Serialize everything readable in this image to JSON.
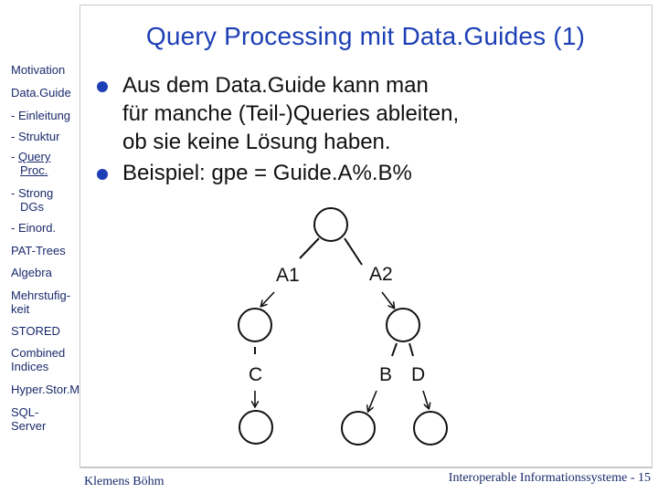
{
  "title": "Query Processing mit Data.Guides (1)",
  "sidebar": {
    "items": [
      {
        "label": "Motivation"
      },
      {
        "label": "Data.Guide"
      },
      {
        "label": "- Einleitung"
      },
      {
        "label": "- Struktur"
      },
      {
        "prefix": "- ",
        "label_line1": "Query",
        "label_line2": "Proc.",
        "active": true
      },
      {
        "label_line1": "- Strong",
        "label_line2": "DGs"
      },
      {
        "label": "- Einord."
      },
      {
        "label": "PAT-Trees"
      },
      {
        "label": "Algebra"
      },
      {
        "label_line1": "Mehrstufig-",
        "label_line2": "keit"
      },
      {
        "label": "STORED"
      },
      {
        "label_line1": "Combined",
        "label_line2": "Indices"
      },
      {
        "label": "Hyper.Stor.M"
      },
      {
        "label_line1": "SQL-",
        "label_line2": "Server"
      }
    ]
  },
  "bullets": [
    {
      "lines": [
        "Aus dem Data.Guide kann man",
        "für manche (Teil-)Queries ableiten,",
        "ob sie keine Lösung haben."
      ]
    },
    {
      "lines": [
        "Beispiel: gpe = Guide.A%.B%"
      ]
    }
  ],
  "diagram": {
    "edge_labels": {
      "a1": "A1",
      "a2": "A2",
      "c": "C",
      "b": "B",
      "d": "D"
    }
  },
  "footer": {
    "author": "Klemens Böhm",
    "course": "Interoperable Informationssysteme - 15"
  }
}
